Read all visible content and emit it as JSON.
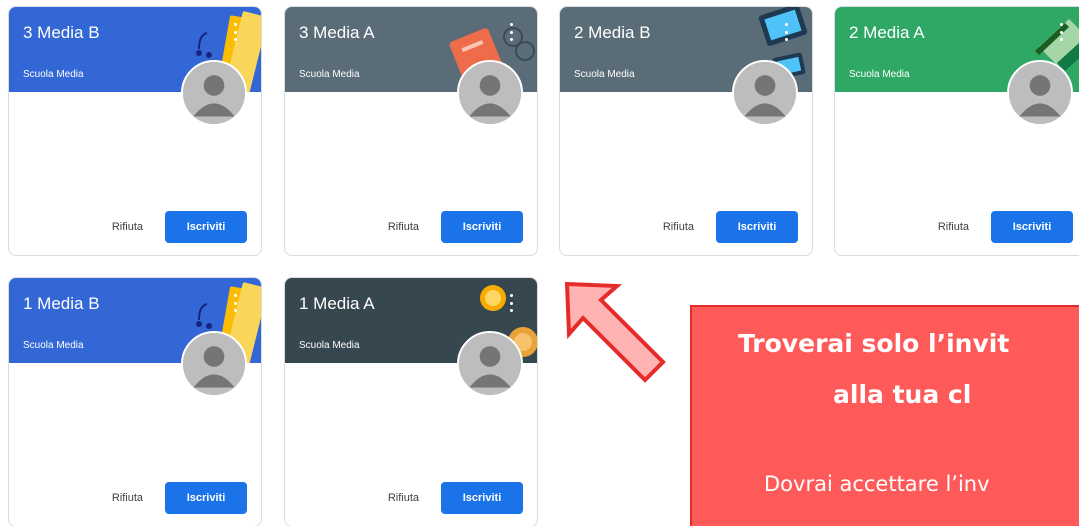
{
  "classes": [
    {
      "title": "3 Media B",
      "subtitle": "Scuola Media",
      "color": "#3367d6",
      "illustration": "headphones-notebook"
    },
    {
      "title": "3 Media A",
      "subtitle": "Scuola Media",
      "color": "#5a6c78",
      "illustration": "book-glasses"
    },
    {
      "title": "2 Media B",
      "subtitle": "Scuola Media",
      "color": "#5a6c78",
      "illustration": "devices"
    },
    {
      "title": "2 Media A",
      "subtitle": "Scuola Media",
      "color": "#2fa866",
      "illustration": "open-book"
    },
    {
      "title": "1 Media B",
      "subtitle": "Scuola Media",
      "color": "#3367d6",
      "illustration": "headphones-notebook"
    },
    {
      "title": "1 Media A",
      "subtitle": "Scuola Media",
      "color": "#37474f",
      "illustration": "planets"
    }
  ],
  "actions": {
    "reject_label": "Rifiuta",
    "join_label": "Iscriviti",
    "join_color": "#1a73e8"
  },
  "callout": {
    "line1": "Troverai solo l’invit",
    "line2": "alla tua cl",
    "body": "Dovrai accettare l’inv",
    "color": "#ff5a5a"
  }
}
